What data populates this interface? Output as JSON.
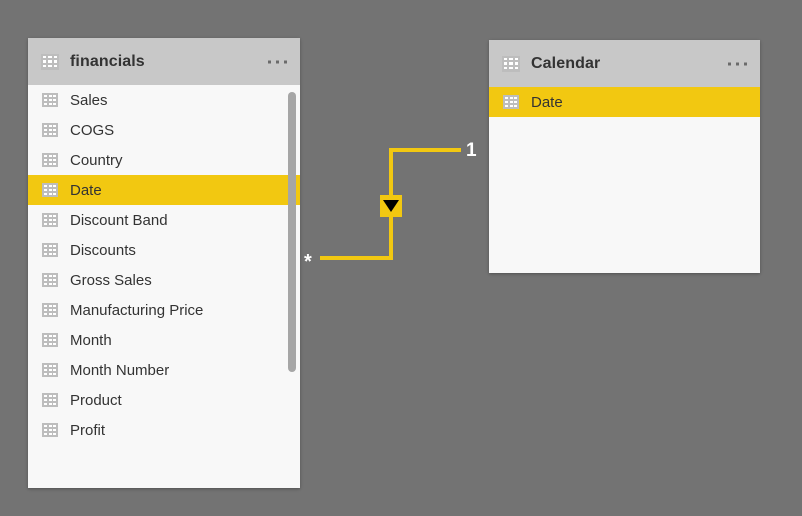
{
  "canvas": {
    "background_color": "#737373",
    "accent_color": "#f2c811",
    "header_color": "#c8c8c8",
    "card_background": "#f8f8f8"
  },
  "tables": [
    {
      "name": "financials",
      "title": "financials",
      "icon": "table-icon",
      "menu_icon": "ellipsis-icon",
      "has_scrollbar": true,
      "fields": [
        {
          "label": "Sales",
          "selected": false
        },
        {
          "label": "COGS",
          "selected": false
        },
        {
          "label": "Country",
          "selected": false
        },
        {
          "label": "Date",
          "selected": true
        },
        {
          "label": "Discount Band",
          "selected": false
        },
        {
          "label": "Discounts",
          "selected": false
        },
        {
          "label": "Gross Sales",
          "selected": false
        },
        {
          "label": "Manufacturing Price",
          "selected": false
        },
        {
          "label": "Month",
          "selected": false
        },
        {
          "label": "Month Number",
          "selected": false
        },
        {
          "label": "Product",
          "selected": false
        },
        {
          "label": "Profit",
          "selected": false
        }
      ]
    },
    {
      "name": "Calendar",
      "title": "Calendar",
      "icon": "table-icon",
      "menu_icon": "ellipsis-icon",
      "has_scrollbar": false,
      "fields": [
        {
          "label": "Date",
          "selected": true
        }
      ]
    }
  ],
  "relationship": {
    "from_table": "financials",
    "from_field": "Date",
    "to_table": "Calendar",
    "to_field": "Date",
    "from_cardinality": "*",
    "to_cardinality": "1",
    "cross_filter_direction": "single",
    "line_color": "#f2c811",
    "arrow_icon": "filter-direction-arrow-icon"
  }
}
